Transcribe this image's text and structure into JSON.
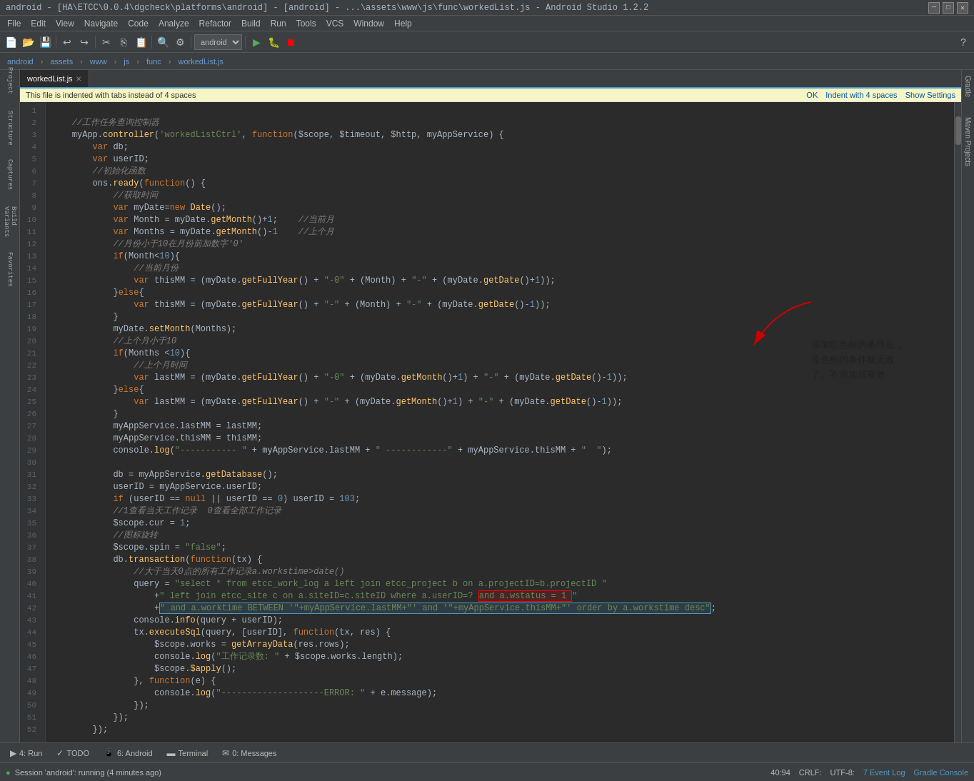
{
  "titleBar": {
    "text": "android - [HA\\ETCC\\0.0.4\\dgcheck\\platforms\\android] - [android] - ...\\assets\\www\\js\\func\\workedList.js - Android Studio 1.2.2",
    "minimize": "─",
    "maximize": "□",
    "close": "✕"
  },
  "menuBar": {
    "items": [
      "File",
      "Edit",
      "View",
      "Navigate",
      "Code",
      "Analyze",
      "Refactor",
      "Build",
      "Run",
      "Tools",
      "VCS",
      "Window",
      "Help"
    ]
  },
  "navTabs": {
    "items": [
      "android",
      "assets",
      "www",
      "js",
      "func",
      "workedList.js"
    ]
  },
  "fileTab": {
    "name": "workedList.js",
    "close": "✕"
  },
  "notifBar": {
    "text": "This file is indented with tabs instead of 4 spaces",
    "ok": "OK",
    "indent": "Indent with 4 spaces",
    "settings": "Show Settings"
  },
  "statusBar": {
    "left": "Session 'android': running (4 minutes ago)",
    "position": "40:94",
    "lineEnding": "CRLF:",
    "encoding": "UTF-8:",
    "eventLog": "7 Event Log",
    "gradleConsole": "Gradle Console"
  },
  "bottomTabs": [
    {
      "icon": "▶",
      "label": "4: Run"
    },
    {
      "icon": "✓",
      "label": "TODO"
    },
    {
      "icon": "☎",
      "label": "6: Android"
    },
    {
      "icon": "▬",
      "label": "Terminal"
    },
    {
      "icon": "✉",
      "label": "0: Messages"
    }
  ],
  "annotation": {
    "line1": "添加红色框的条件后，",
    "line2": "蓝色框的条件就无效",
    "line3": "了。不添加就有效"
  },
  "code": {
    "lines": [
      {
        "n": 1,
        "text": "    //工作任务查询控制器"
      },
      {
        "n": 2,
        "text": "    myApp.controller('workedListCtrl', function($scope, $timeout, $http, myAppService) {"
      },
      {
        "n": 3,
        "text": "        var db;"
      },
      {
        "n": 4,
        "text": "        var userID;"
      },
      {
        "n": 5,
        "text": "        //初始化函数"
      },
      {
        "n": 6,
        "text": "        ons.ready(function() {"
      },
      {
        "n": 7,
        "text": "            //获取时间"
      },
      {
        "n": 8,
        "text": "            var myDate=new Date();"
      },
      {
        "n": 9,
        "text": "            var Month = myDate.getMonth()+1;    //当前月"
      },
      {
        "n": 10,
        "text": "            var Months = myDate.getMonth()-1    //上个月"
      },
      {
        "n": 11,
        "text": "            //月份小于10在月份前加数字'0'"
      },
      {
        "n": 12,
        "text": "            if(Month<10){"
      },
      {
        "n": 13,
        "text": "                //当前月份"
      },
      {
        "n": 14,
        "text": "                var thisMM = (myDate.getFullYear() + \"-0\" + (Month) + \"-\" + (myDate.getDate()+1));"
      },
      {
        "n": 15,
        "text": "            }else{"
      },
      {
        "n": 16,
        "text": "                var thisMM = (myDate.getFullYear() + \"-\" + (Month) + \"-\" + (myDate.getDate()-1));"
      },
      {
        "n": 17,
        "text": "            }"
      },
      {
        "n": 18,
        "text": "            myDate.setMonth(Months);"
      },
      {
        "n": 19,
        "text": "            //上个月小于10"
      },
      {
        "n": 20,
        "text": "            if(Months <10){"
      },
      {
        "n": 21,
        "text": "                //上个月时间"
      },
      {
        "n": 22,
        "text": "                var lastMM = (myDate.getFullYear() + \"-0\" + (myDate.getMonth()+1) + \"-\" + (myDate.getDate()-1));"
      },
      {
        "n": 23,
        "text": "            }else{"
      },
      {
        "n": 24,
        "text": "                var lastMM = (myDate.getFullYear() + \"-\" + (myDate.getMonth()+1) + \"-\" + (myDate.getDate()-1));"
      },
      {
        "n": 25,
        "text": "            }"
      },
      {
        "n": 26,
        "text": "            myAppService.lastMM = lastMM;"
      },
      {
        "n": 27,
        "text": "            myAppService.thisMM = thisMM;"
      },
      {
        "n": 28,
        "text": "            console.log(\"----------- \" + myAppService.lastMM + \" ------------\" + myAppService.thisMM + \"  \");"
      },
      {
        "n": 29,
        "text": ""
      },
      {
        "n": 30,
        "text": "            db = myAppService.getDatabase();"
      },
      {
        "n": 31,
        "text": "            userID = myAppService.userID;"
      },
      {
        "n": 32,
        "text": "            if (userID == null || userID == 0) userID = 103;"
      },
      {
        "n": 33,
        "text": "            //1查看当天工作记录  0查看全部工作记录"
      },
      {
        "n": 34,
        "text": "            $scope.cur = 1;"
      },
      {
        "n": 35,
        "text": "            //图标旋转"
      },
      {
        "n": 36,
        "text": "            $scope.spin = \"false\";"
      },
      {
        "n": 37,
        "text": "            db.transaction(function(tx) {"
      },
      {
        "n": 38,
        "text": "                //大于当天0点的所有工作记录a.workstime>date()"
      },
      {
        "n": 39,
        "text": "                query = \"select * from etcc_work_log a left join etcc_project b on a.projectID=b.projectID \""
      },
      {
        "n": 40,
        "text": "                    +\" left join etcc_site c on a.siteID=c.siteID where a.userID=? and a.wstatus = 1 \""
      },
      {
        "n": 41,
        "text": "                    +\" and a.worktime BETWEEN '\"+myAppService.lastMM+\"' and '\"+myAppService.thisMM+\"' order by a.workstime desc\";"
      },
      {
        "n": 42,
        "text": "                console.info(query + userID);"
      },
      {
        "n": 43,
        "text": "                tx.executeSql(query, [userID], function(tx, res) {"
      },
      {
        "n": 44,
        "text": "                    $scope.works = getArrayData(res.rows);"
      },
      {
        "n": 45,
        "text": "                    console.log(\"工作记录数: \" + $scope.works.length);"
      },
      {
        "n": 46,
        "text": "                    $scope.$apply();"
      },
      {
        "n": 47,
        "text": "                }, function(e) {"
      },
      {
        "n": 48,
        "text": "                    console.log(\"--------------------ERROR: \" + e.message);"
      },
      {
        "n": 49,
        "text": "                });"
      },
      {
        "n": 50,
        "text": "            });"
      },
      {
        "n": 51,
        "text": "        });"
      },
      {
        "n": 52,
        "text": ""
      }
    ]
  }
}
